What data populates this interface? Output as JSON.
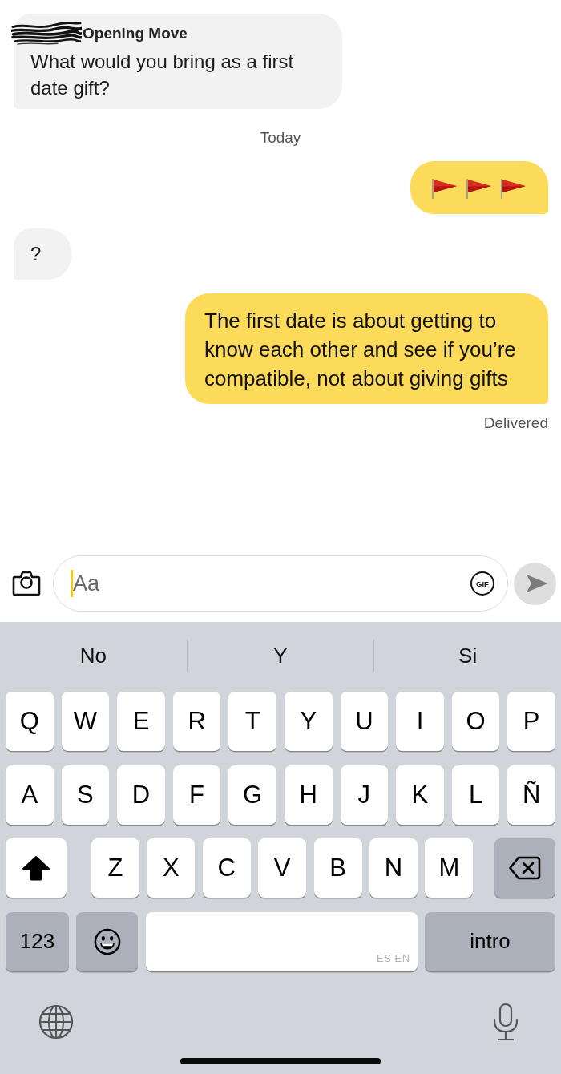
{
  "messages": [
    {
      "kind": "received",
      "name_redacted": true,
      "title": "Opening Move",
      "text": "What would you bring as a first date gift?"
    },
    {
      "kind": "date",
      "text": "Today"
    },
    {
      "kind": "sent",
      "icons": [
        {
          "kind": "flag"
        },
        {
          "kind": "flag"
        },
        {
          "kind": "flag"
        }
      ]
    },
    {
      "kind": "received",
      "text": "?"
    },
    {
      "kind": "sent",
      "text": "The first date is about getting to know each other and see if you’re compatible, not about giving gifts"
    },
    {
      "kind": "status",
      "text": "Delivered"
    }
  ],
  "composer": {
    "placeholder": "Aa",
    "focused": true,
    "gif_label": "GIF",
    "send": {
      "disabled": true
    }
  },
  "keyboard": {
    "suggestions": [
      "No",
      "Y",
      "Si"
    ],
    "rows": [
      {
        "keys": [
          {
            "kind": "letter",
            "label": "Q"
          },
          {
            "kind": "letter",
            "label": "W"
          },
          {
            "kind": "letter",
            "label": "E"
          },
          {
            "kind": "letter",
            "label": "R"
          },
          {
            "kind": "letter",
            "label": "T"
          },
          {
            "kind": "letter",
            "label": "Y"
          },
          {
            "kind": "letter",
            "label": "U"
          },
          {
            "kind": "letter",
            "label": "I"
          },
          {
            "kind": "letter",
            "label": "O"
          },
          {
            "kind": "letter",
            "label": "P"
          }
        ]
      },
      {
        "keys": [
          {
            "kind": "letter",
            "label": "A"
          },
          {
            "kind": "letter",
            "label": "S"
          },
          {
            "kind": "letter",
            "label": "D"
          },
          {
            "kind": "letter",
            "label": "F"
          },
          {
            "kind": "letter",
            "label": "G"
          },
          {
            "kind": "letter",
            "label": "H"
          },
          {
            "kind": "letter",
            "label": "J"
          },
          {
            "kind": "letter",
            "label": "K"
          },
          {
            "kind": "letter",
            "label": "L"
          },
          {
            "kind": "letter",
            "label": "Ñ"
          }
        ]
      },
      {
        "keys": [
          {
            "kind": "shift",
            "on": true
          },
          {
            "kind": "letter",
            "label": "Z"
          },
          {
            "kind": "letter",
            "label": "X"
          },
          {
            "kind": "letter",
            "label": "C"
          },
          {
            "kind": "letter",
            "label": "V"
          },
          {
            "kind": "letter",
            "label": "B"
          },
          {
            "kind": "letter",
            "label": "N"
          },
          {
            "kind": "letter",
            "label": "M"
          },
          {
            "kind": "backspace"
          }
        ]
      },
      {
        "keys": [
          {
            "kind": "mode",
            "label": "123"
          },
          {
            "kind": "emoji"
          },
          {
            "kind": "space",
            "label": "ES EN"
          },
          {
            "kind": "return",
            "label": "intro"
          }
        ]
      }
    ]
  }
}
